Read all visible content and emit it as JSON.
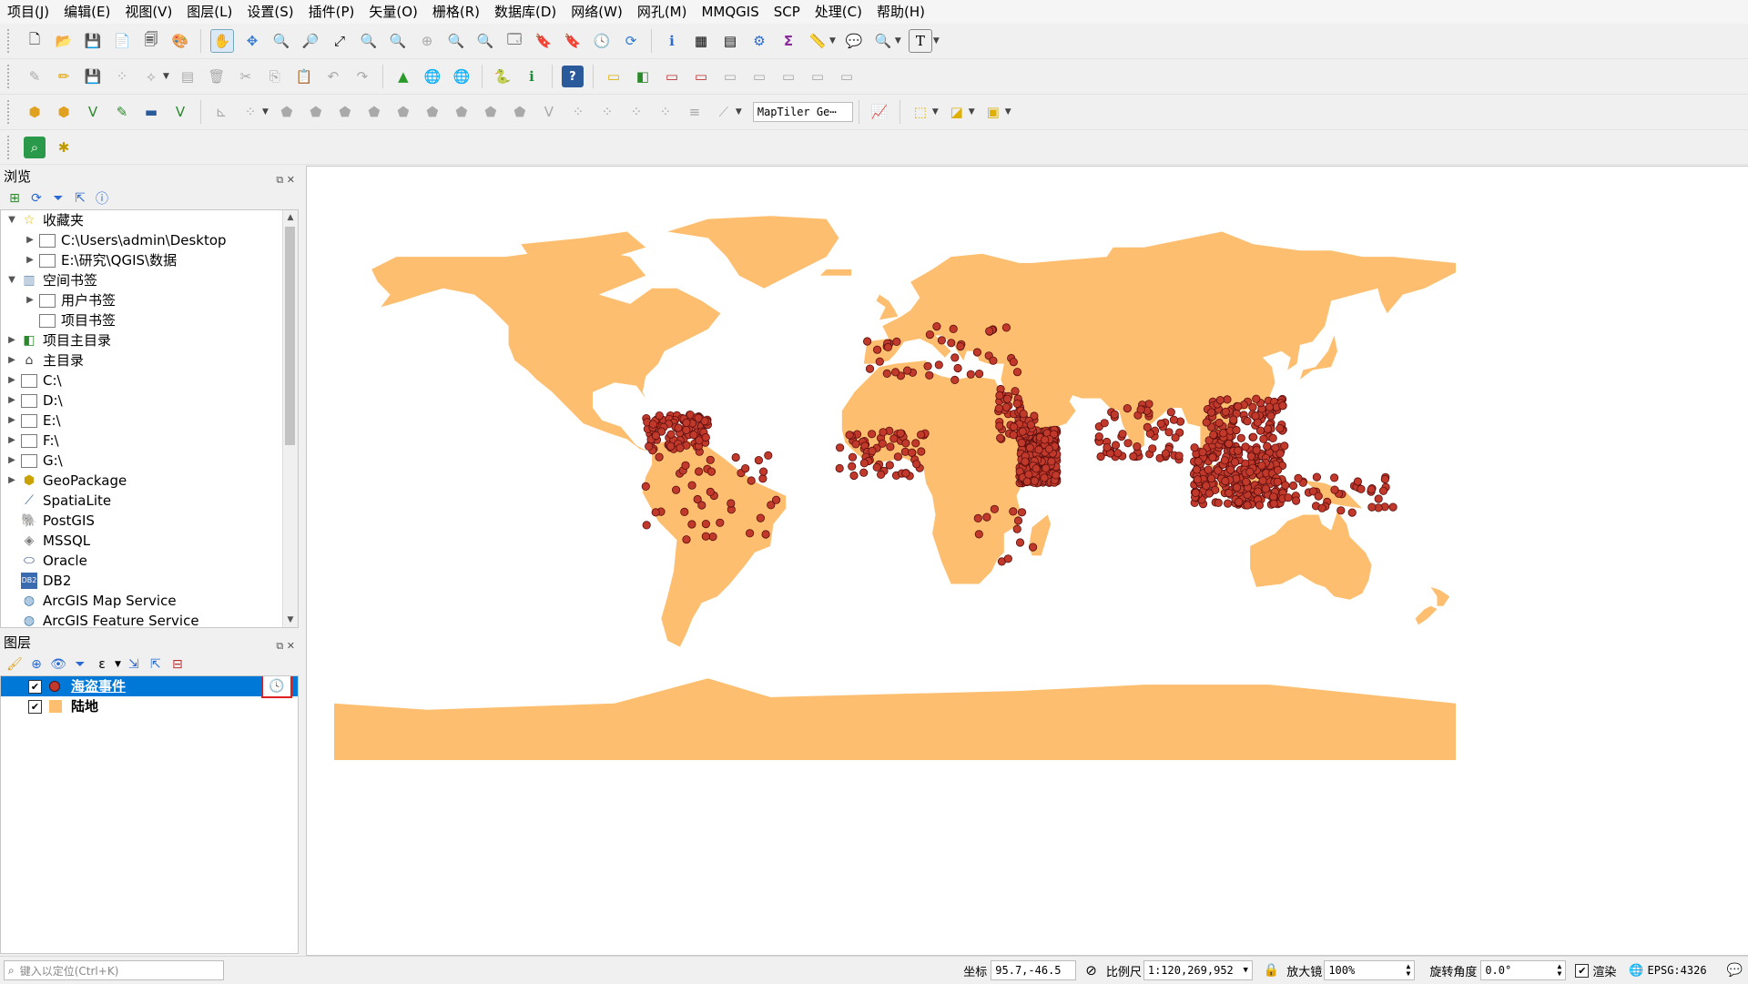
{
  "menu": [
    "项目(J)",
    "编辑(E)",
    "视图(V)",
    "图层(L)",
    "设置(S)",
    "插件(P)",
    "矢量(O)",
    "栅格(R)",
    "数据库(D)",
    "网络(W)",
    "网孔(M)",
    "MMQGIS",
    "SCP",
    "处理(C)",
    "帮助(H)"
  ],
  "toolbar": {
    "geocoder_value": "MapTiler Ge⋯",
    "text_tool_label": "T"
  },
  "browser": {
    "title": "浏览",
    "items": [
      {
        "label": "收藏夹",
        "icon": "star-icon"
      },
      {
        "label": "C:\\Users\\admin\\Desktop",
        "icon": "folder-icon"
      },
      {
        "label": "E:\\研究\\QGIS\\数据",
        "icon": "folder-icon"
      },
      {
        "label": "空间书签",
        "icon": "bookmark-icon"
      },
      {
        "label": "用户书签",
        "icon": "folder-icon"
      },
      {
        "label": "项目书签",
        "icon": "folder-icon"
      },
      {
        "label": "项目主目录",
        "icon": "project-home-icon"
      },
      {
        "label": "主目录",
        "icon": "home-icon"
      },
      {
        "label": "C:\\",
        "icon": "folder-icon"
      },
      {
        "label": "D:\\",
        "icon": "folder-icon"
      },
      {
        "label": "E:\\",
        "icon": "folder-icon"
      },
      {
        "label": "F:\\",
        "icon": "folder-icon"
      },
      {
        "label": "G:\\",
        "icon": "folder-icon"
      },
      {
        "label": "GeoPackage",
        "icon": "geopackage-icon"
      },
      {
        "label": "SpatiaLite",
        "icon": "spatialite-icon"
      },
      {
        "label": "PostGIS",
        "icon": "postgis-icon"
      },
      {
        "label": "MSSQL",
        "icon": "mssql-icon"
      },
      {
        "label": "Oracle",
        "icon": "oracle-icon"
      },
      {
        "label": "DB2",
        "icon": "db2-icon"
      },
      {
        "label": "ArcGIS Map Service",
        "icon": "arcgis-icon"
      },
      {
        "label": "ArcGIS Feature Service",
        "icon": "arcgis-icon"
      }
    ]
  },
  "layers": {
    "title": "图层",
    "items": [
      {
        "label": "海盗事件",
        "checked": true,
        "selected": true,
        "symbol_color": "#c0392b"
      },
      {
        "label": "陆地",
        "checked": true,
        "selected": false,
        "symbol_color": "#fdbf6f"
      }
    ]
  },
  "map": {
    "land_color": "#fdbf6f",
    "point_color": "#c0392b",
    "point_stroke": "#5a0e0e"
  },
  "status": {
    "locate_placeholder": "键入以定位(Ctrl+K)",
    "coord_label": "坐标",
    "coord_value": "95.7,-46.5",
    "scale_label": "比例尺",
    "scale_value": "1:120,269,952",
    "magnifier_label": "放大镜",
    "magnifier_value": "100%",
    "rotation_label": "旋转角度",
    "rotation_value": "0.0°",
    "render_label": "渲染",
    "crs_value": "EPSG:4326"
  }
}
